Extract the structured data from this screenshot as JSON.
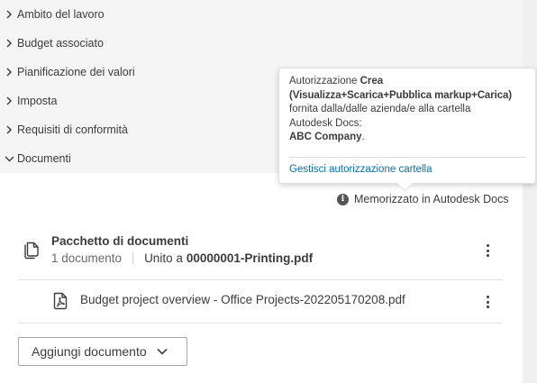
{
  "sections": [
    {
      "label": "Ambito del lavoro",
      "expanded": false
    },
    {
      "label": "Budget associato",
      "expanded": false
    },
    {
      "label": "Pianificazione dei valori",
      "expanded": false
    },
    {
      "label": "Imposta",
      "expanded": false
    },
    {
      "label": "Requisiti di conformità",
      "expanded": false
    },
    {
      "label": "Documenti",
      "expanded": true
    }
  ],
  "tooltip": {
    "line1_prefix": "Autorizzazione ",
    "line1_bold": "Crea",
    "permissions": "(Visualizza+Scarica+Pubblica markup+Carica)",
    "line3": "fornita dalla/dalle azienda/e alla cartella",
    "line4": "Autodesk Docs:",
    "company": "ABC Company",
    "company_suffix": ".",
    "link": "Gestisci autorizzazione cartella"
  },
  "documents": {
    "stored_note": "Memorizzato in Autodesk Docs",
    "info_icon": "info-icon",
    "package": {
      "title": "Pacchetto di documenti",
      "count": "1 documento",
      "joined_prefix": "Unito a",
      "joined_file": "00000001-Printing.pdf"
    },
    "files": [
      {
        "name": "Budget project overview - Office Projects-202205170208.pdf",
        "icon": "pdf-icon"
      }
    ],
    "add_button": "Aggiungi documento"
  },
  "colors": {
    "link": "#0a6fae",
    "section_bg": "#f5f5f5",
    "text": "#3c3c3c",
    "muted": "#6a6a6a"
  }
}
